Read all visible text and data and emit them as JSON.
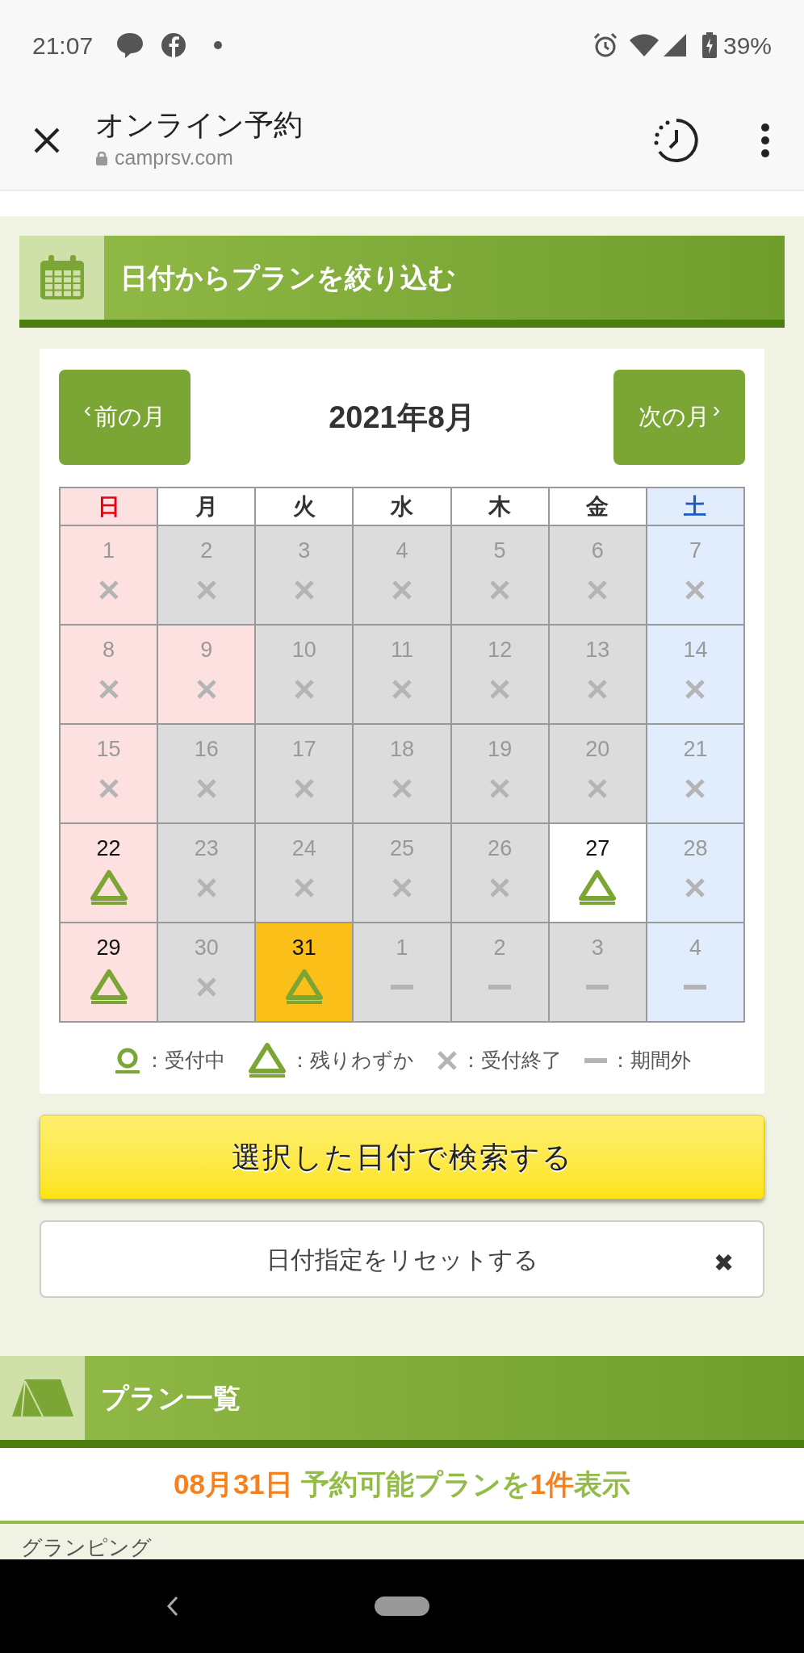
{
  "status_bar": {
    "time": "21:07",
    "battery": "39%"
  },
  "browser": {
    "title": "オンライン予約",
    "url": "camprsv.com"
  },
  "filter_section": {
    "title": "日付からプランを絞り込む"
  },
  "calendar": {
    "prev": "前の月",
    "next": "次の月",
    "prev_arrow": "‹",
    "next_arrow": "›",
    "month": "2021年8月",
    "weekdays": [
      {
        "label": "日",
        "holiday": true,
        "saturday": false
      },
      {
        "label": "月",
        "holiday": false,
        "saturday": false
      },
      {
        "label": "火",
        "holiday": false,
        "saturday": false
      },
      {
        "label": "水",
        "holiday": false,
        "saturday": false
      },
      {
        "label": "木",
        "holiday": false,
        "saturday": false
      },
      {
        "label": "金",
        "holiday": false,
        "saturday": false
      },
      {
        "label": "土",
        "holiday": false,
        "saturday": true
      }
    ],
    "weeks": [
      [
        {
          "day": "1",
          "holiday": true,
          "saturday": false,
          "kind": "closed",
          "selected": false
        },
        {
          "day": "2",
          "holiday": false,
          "saturday": false,
          "kind": "closed",
          "selected": false
        },
        {
          "day": "3",
          "holiday": false,
          "saturday": false,
          "kind": "closed",
          "selected": false
        },
        {
          "day": "4",
          "holiday": false,
          "saturday": false,
          "kind": "closed",
          "selected": false
        },
        {
          "day": "5",
          "holiday": false,
          "saturday": false,
          "kind": "closed",
          "selected": false
        },
        {
          "day": "6",
          "holiday": false,
          "saturday": false,
          "kind": "closed",
          "selected": false
        },
        {
          "day": "7",
          "holiday": false,
          "saturday": true,
          "kind": "closed",
          "selected": false
        }
      ],
      [
        {
          "day": "8",
          "holiday": true,
          "saturday": false,
          "kind": "closed",
          "selected": false
        },
        {
          "day": "9",
          "holiday": true,
          "saturday": false,
          "kind": "closed",
          "selected": false
        },
        {
          "day": "10",
          "holiday": false,
          "saturday": false,
          "kind": "closed",
          "selected": false
        },
        {
          "day": "11",
          "holiday": false,
          "saturday": false,
          "kind": "closed",
          "selected": false
        },
        {
          "day": "12",
          "holiday": false,
          "saturday": false,
          "kind": "closed",
          "selected": false
        },
        {
          "day": "13",
          "holiday": false,
          "saturday": false,
          "kind": "closed",
          "selected": false
        },
        {
          "day": "14",
          "holiday": false,
          "saturday": true,
          "kind": "closed",
          "selected": false
        }
      ],
      [
        {
          "day": "15",
          "holiday": true,
          "saturday": false,
          "kind": "closed",
          "selected": false
        },
        {
          "day": "16",
          "holiday": false,
          "saturday": false,
          "kind": "closed",
          "selected": false
        },
        {
          "day": "17",
          "holiday": false,
          "saturday": false,
          "kind": "closed",
          "selected": false
        },
        {
          "day": "18",
          "holiday": false,
          "saturday": false,
          "kind": "closed",
          "selected": false
        },
        {
          "day": "19",
          "holiday": false,
          "saturday": false,
          "kind": "closed",
          "selected": false
        },
        {
          "day": "20",
          "holiday": false,
          "saturday": false,
          "kind": "closed",
          "selected": false
        },
        {
          "day": "21",
          "holiday": false,
          "saturday": true,
          "kind": "closed",
          "selected": false
        }
      ],
      [
        {
          "day": "22",
          "holiday": true,
          "saturday": false,
          "kind": "few",
          "selected": false
        },
        {
          "day": "23",
          "holiday": false,
          "saturday": false,
          "kind": "closed",
          "selected": false
        },
        {
          "day": "24",
          "holiday": false,
          "saturday": false,
          "kind": "closed",
          "selected": false
        },
        {
          "day": "25",
          "holiday": false,
          "saturday": false,
          "kind": "closed",
          "selected": false
        },
        {
          "day": "26",
          "holiday": false,
          "saturday": false,
          "kind": "closed",
          "selected": false
        },
        {
          "day": "27",
          "holiday": false,
          "saturday": false,
          "kind": "few",
          "selected": false
        },
        {
          "day": "28",
          "holiday": false,
          "saturday": true,
          "kind": "closed",
          "selected": false
        }
      ],
      [
        {
          "day": "29",
          "holiday": true,
          "saturday": false,
          "kind": "few",
          "selected": false
        },
        {
          "day": "30",
          "holiday": false,
          "saturday": false,
          "kind": "closed",
          "selected": false
        },
        {
          "day": "31",
          "holiday": false,
          "saturday": false,
          "kind": "few",
          "selected": true
        },
        {
          "day": "1",
          "holiday": false,
          "saturday": false,
          "kind": "outside",
          "selected": false
        },
        {
          "day": "2",
          "holiday": false,
          "saturday": false,
          "kind": "outside",
          "selected": false
        },
        {
          "day": "3",
          "holiday": false,
          "saturday": false,
          "kind": "outside",
          "selected": false
        },
        {
          "day": "4",
          "holiday": false,
          "saturday": true,
          "kind": "outside",
          "selected": false
        }
      ]
    ],
    "legend": [
      {
        "kind": "open",
        "label": "：受付中"
      },
      {
        "kind": "few",
        "label": "：残りわずか"
      },
      {
        "kind": "closed",
        "label": "：受付終了"
      },
      {
        "kind": "outside",
        "label": "：期間外"
      }
    ]
  },
  "search_button": "選択した日付で検索する",
  "reset_button": {
    "label": "日付指定をリセットする",
    "icon": "✖"
  },
  "plans_section": {
    "title": "プラン一覧",
    "summary": [
      {
        "text": "08月31日",
        "kind": "highlight"
      },
      {
        "text": " 予約可能プランを",
        "kind": "normal"
      },
      {
        "text": "1件",
        "kind": "highlight"
      },
      {
        "text": "表示",
        "kind": "normal"
      }
    ],
    "first_category": "グランピング"
  }
}
